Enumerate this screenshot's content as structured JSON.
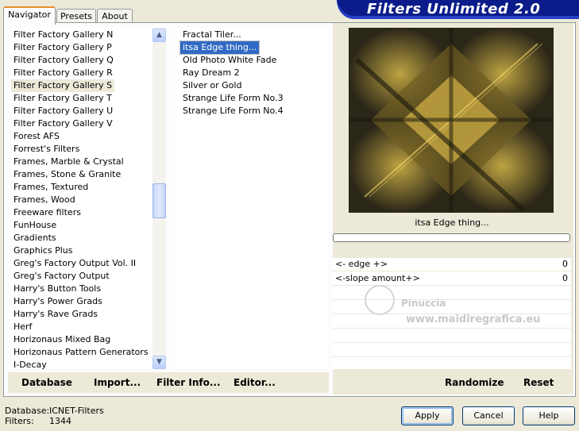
{
  "app": {
    "title": "Filters Unlimited 2.0"
  },
  "tabs": [
    {
      "label": "Navigator",
      "active": true
    },
    {
      "label": "Presets",
      "active": false
    },
    {
      "label": "About",
      "active": false
    }
  ],
  "categories": {
    "items": [
      "Filter Factory Gallery N",
      "Filter Factory Gallery P",
      "Filter Factory Gallery Q",
      "Filter Factory Gallery R",
      "Filter Factory Gallery S",
      "Filter Factory Gallery T",
      "Filter Factory Gallery U",
      "Filter Factory Gallery V",
      "Forest AFS",
      "Forrest's Filters",
      "Frames, Marble & Crystal",
      "Frames, Stone & Granite",
      "Frames, Textured",
      "Frames, Wood",
      "Freeware filters",
      "FunHouse",
      "Gradients",
      "Graphics Plus",
      "Greg's Factory Output Vol. II",
      "Greg's Factory Output",
      "Harry's Button Tools",
      "Harry's Power Grads",
      "Harry's Rave Grads",
      "Herf",
      "Horizonaus Mixed Bag",
      "Horizonaus Pattern Generators",
      "I-Decay"
    ],
    "selected": "Filter Factory Gallery S"
  },
  "filters": {
    "items": [
      "Fractal Tiler...",
      "itsa Edge thing...",
      "Old Photo White Fade",
      "Ray Dream 2",
      "Silver or Gold",
      "Strange Life Form No.3",
      "Strange Life Form No.4"
    ],
    "selected": "itsa Edge thing..."
  },
  "left_buttons": [
    {
      "label": "Database"
    },
    {
      "label": "Import..."
    },
    {
      "label": "Filter Info..."
    },
    {
      "label": "Editor..."
    }
  ],
  "preview": {
    "filter_name": "itsa Edge thing...",
    "watermark_name": "Pinuccia",
    "watermark_url": "www.maidiregrafica.eu"
  },
  "params": [
    {
      "label": "<- edge +>",
      "value": "0"
    },
    {
      "label": "<-slope amount+>",
      "value": "0"
    }
  ],
  "right_buttons": {
    "randomize": "Randomize",
    "reset": "Reset"
  },
  "status": {
    "database_label": "Database:",
    "database_value": "ICNET-Filters",
    "filters_label": "Filters:",
    "filters_value": "1344"
  },
  "dialog_buttons": {
    "apply": "Apply",
    "cancel": "Cancel",
    "help": "Help"
  },
  "colors": {
    "banner": "#0b1c8a",
    "selection": "#316ac5",
    "preview_gold": "#c8a73c"
  }
}
